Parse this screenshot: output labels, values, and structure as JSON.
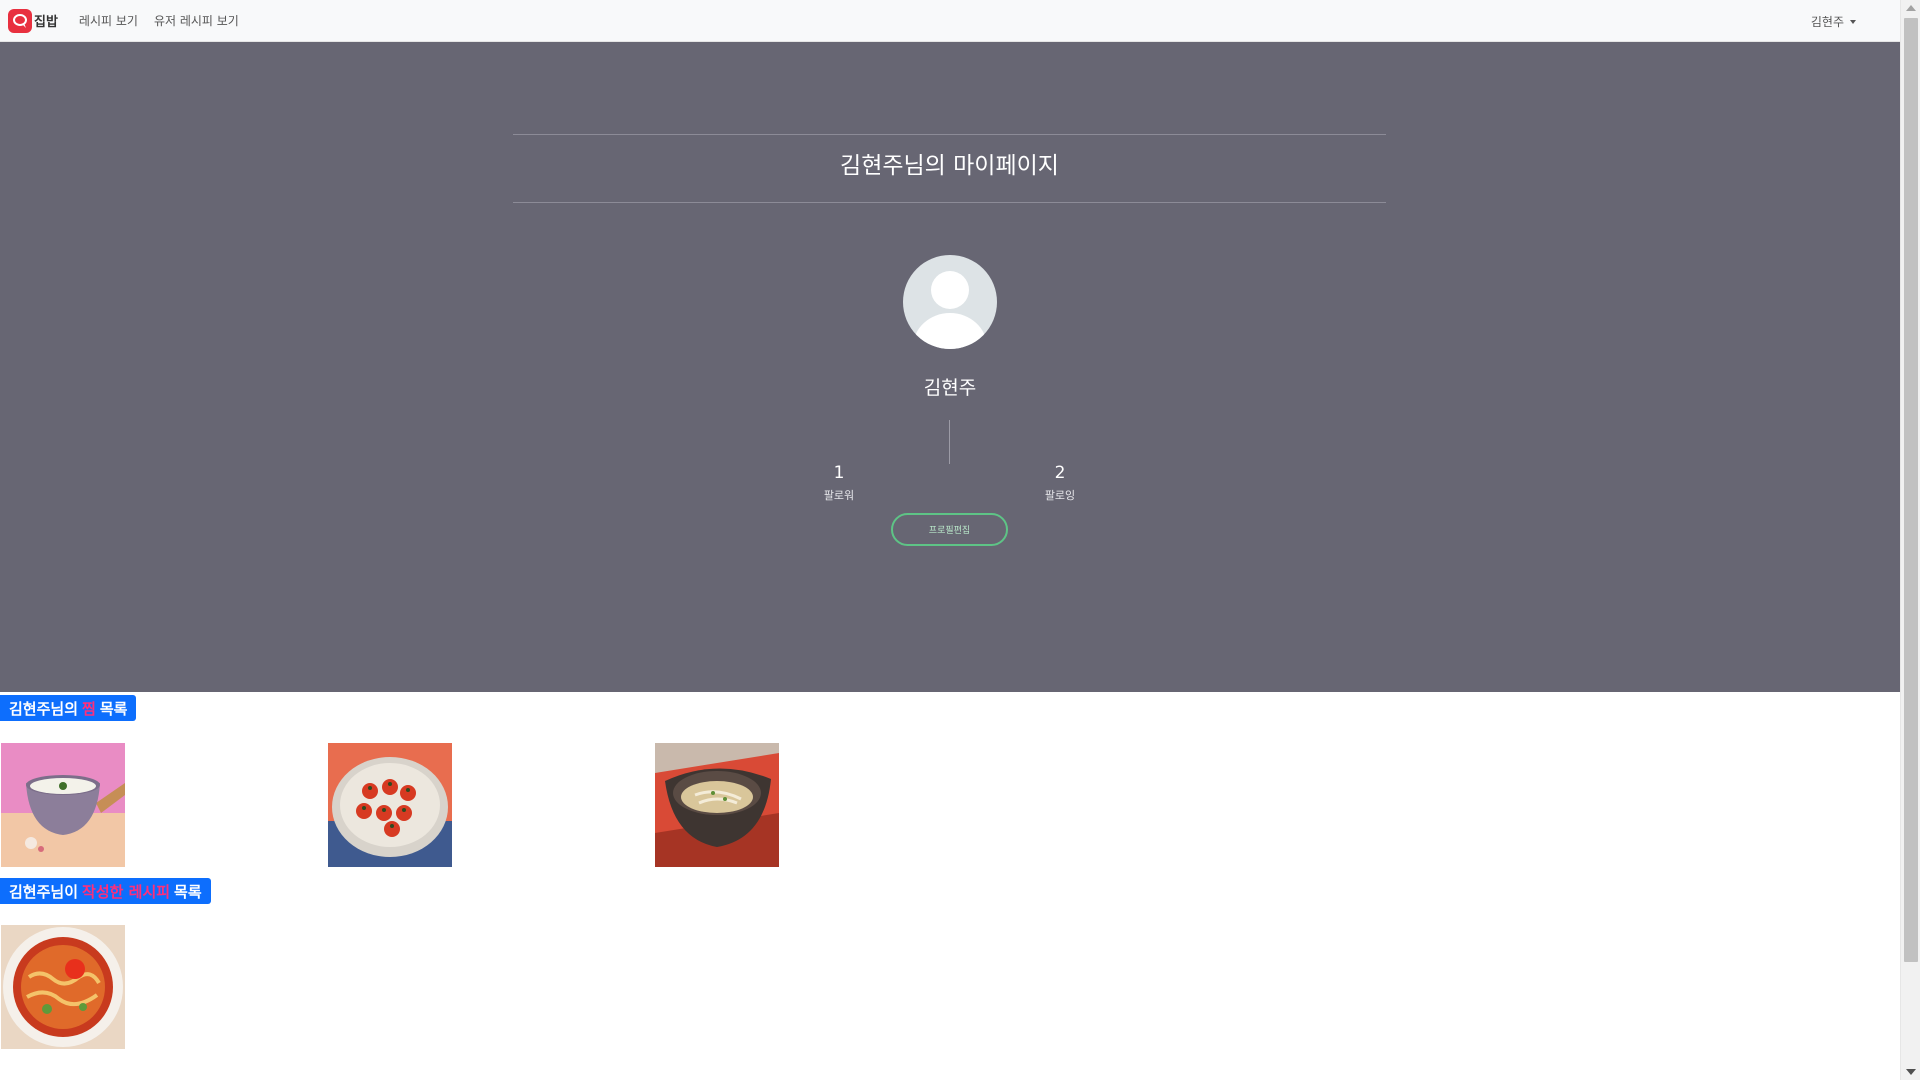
{
  "navbar": {
    "brand": "집밥",
    "links": [
      "레시피 보기",
      "유저 레시피 보기"
    ],
    "user": "김현주"
  },
  "profile": {
    "page_title": "김현주님의 마이페이지",
    "name": "김현주",
    "followers_count": "1",
    "followers_label": "팔로워",
    "following_count": "2",
    "following_label": "팔로잉",
    "edit_button": "프로필편집"
  },
  "sections": {
    "likes": {
      "prefix": "김현주님의",
      "highlight": "찜",
      "suffix": "목록"
    },
    "recipes": {
      "prefix": "김현주님이",
      "highlight": "작성한 레시피",
      "suffix": "목록"
    }
  },
  "liked_items": [
    "cream-soup",
    "cherry-tomato-dish",
    "noodle-soup"
  ],
  "recipe_items": [
    "kimchi-ramen"
  ]
}
